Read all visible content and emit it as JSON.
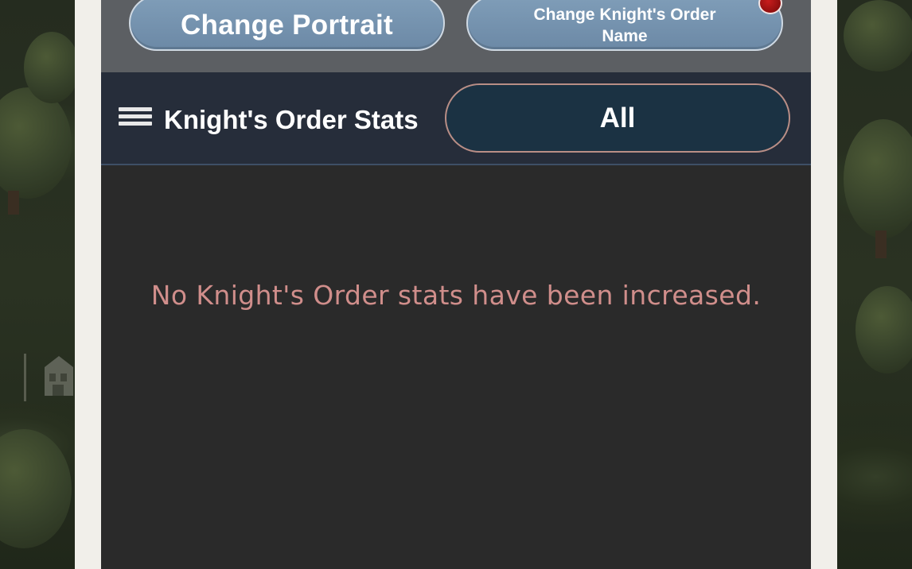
{
  "header": {
    "change_portrait_label": "Change Portrait",
    "change_name_label": "Change Knight's Order Name"
  },
  "stats": {
    "title": "Knight's Order Stats",
    "filter_value": "All",
    "empty_message": "No Knight's Order stats have been increased."
  },
  "icons": {
    "menu": "hamburger-menu-icon",
    "notification": "notification-dot-icon"
  },
  "colors": {
    "button_blue": "#7f9db8",
    "notification_red": "#c81d1d",
    "empty_text": "#d08e8b",
    "filter_bg": "#1b3243"
  }
}
